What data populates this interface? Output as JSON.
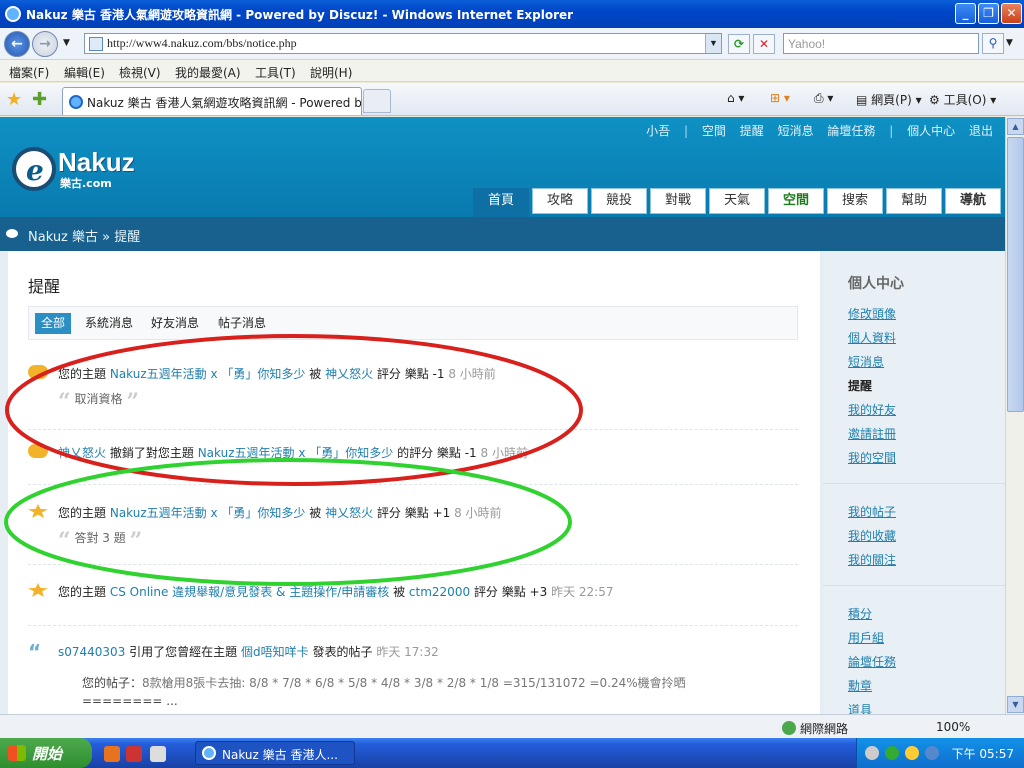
{
  "window": {
    "title": "Nakuz 樂古 香港人氣網遊攻略資訊網 - Powered by Discuz! - Windows Internet Explorer",
    "min": "_",
    "max": "❐",
    "close": "✕"
  },
  "address": {
    "url": "http://www4.nakuz.com/bbs/notice.php",
    "search_placeholder": "Yahoo!"
  },
  "menu": [
    "檔案(F)",
    "編輯(E)",
    "檢視(V)",
    "我的最愛(A)",
    "工具(T)",
    "說明(H)"
  ],
  "tab": {
    "label": "Nakuz 樂古 香港人氣網遊攻略資訊網 - Powered by ..."
  },
  "toolbar": {
    "page": "網頁(P)",
    "tools": "工具(O)"
  },
  "site": {
    "logo_name": "Nakuz",
    "logo_sub": "樂古.com",
    "user": "小吾",
    "top_links": [
      "空間",
      "提醒",
      "短消息",
      "論壇任務",
      "個人中心",
      "退出"
    ],
    "nav": [
      "首頁",
      "攻略",
      "競投",
      "對戰",
      "天氣",
      "空間",
      "搜索",
      "幫助",
      "導航"
    ],
    "breadcrumb": "Nakuz 樂古 » 提醒"
  },
  "main": {
    "heading": "提醒",
    "filters": [
      "全部",
      "系統消息",
      "好友消息",
      "帖子消息"
    ],
    "items": [
      {
        "prefix": "您的主題",
        "topic": "Nakuz五週年活動 x 「勇」你知多少",
        "mid": "被",
        "user": "神乂怒火",
        "action": "評分 樂點 -1",
        "time": "8 小時前",
        "quote": "取消資格"
      },
      {
        "user": "神乂怒火",
        "mid": "撤銷了對您主題",
        "topic": "Nakuz五週年活動 x 「勇」你知多少",
        "action": "的評分 樂點 -1",
        "time": "8 小時前"
      },
      {
        "prefix": "您的主題",
        "topic": "Nakuz五週年活動 x 「勇」你知多少",
        "mid": "被",
        "user": "神乂怒火",
        "action": "評分 樂點 +1",
        "time": "8 小時前",
        "quote": "答對 3 題"
      },
      {
        "prefix": "您的主題",
        "topic": "CS Online 違規舉報/意見發表 & 主題操作/申請審核",
        "mid": "被",
        "user": "ctm22000",
        "action": "評分 樂點 +3",
        "time": "昨天 22:57"
      },
      {
        "user": "s07440303",
        "mid": "引用了您曾經在主題",
        "topic": "個d唔知咩卡",
        "action": "發表的帖子",
        "time": "昨天 17:32",
        "post_label": "您的帖子：",
        "post_text": "8款槍用8張卡去抽: 8/8 * 7/8 * 6/8 * 5/8 * 4/8 * 3/8 * 2/8 * 1/8 =315/131072 =0.24%機會拎晒",
        "post_more": "======== ..."
      }
    ]
  },
  "sidebar": {
    "heading": "個人中心",
    "group1": [
      "修改頭像",
      "個人資料",
      "短消息",
      "提醒",
      "我的好友",
      "邀請註冊",
      "我的空間"
    ],
    "group2": [
      "我的帖子",
      "我的收藏",
      "我的關注"
    ],
    "group3": [
      "積分",
      "用戶組",
      "論壇任務",
      "勳章",
      "道具"
    ]
  },
  "status": {
    "zone": "網際網路",
    "zoom": "100%"
  },
  "taskbar": {
    "start": "開始",
    "task": "Nakuz 樂古 香港人...",
    "clock": "下午 05:57"
  }
}
